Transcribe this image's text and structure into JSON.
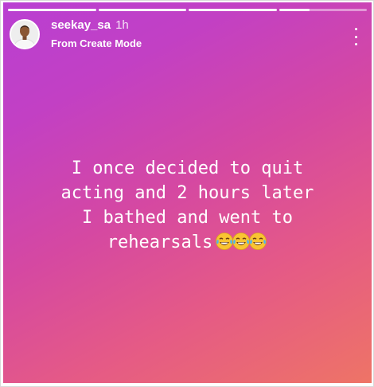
{
  "story": {
    "progress": [
      1,
      1,
      1,
      0.35
    ],
    "colors": {
      "gradient_start": "#b93fd2",
      "gradient_end": "#ee7466"
    }
  },
  "header": {
    "avatar_icon": "profile-avatar",
    "username": "seekay_sa",
    "time": "1h",
    "subtitle": "From Create Mode",
    "menu_icon": "more-vertical-icon"
  },
  "caption": {
    "lines": [
      "I once decided to quit",
      "acting and 2 hours later",
      "I bathed and went to",
      "rehearsals"
    ],
    "emojis": [
      "tears-of-joy-emoji",
      "tears-of-joy-emoji",
      "tears-of-joy-emoji"
    ]
  }
}
